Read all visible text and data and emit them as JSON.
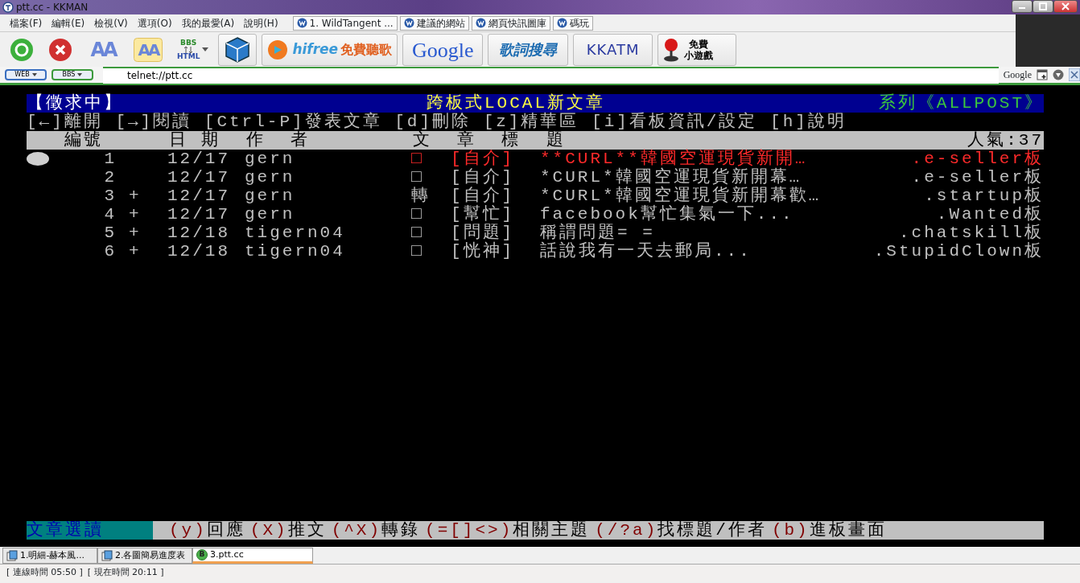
{
  "window": {
    "title": "ptt.cc - KKMAN"
  },
  "menu": [
    "檔案(F)",
    "編輯(E)",
    "檢視(V)",
    "選項(O)",
    "我的最愛(A)",
    "說明(H)"
  ],
  "favorites": [
    "1. WildTangent ...",
    "建議的網站",
    "網頁快訊圖庫",
    "碼玩"
  ],
  "toolbar": [
    {
      "kind": "go"
    },
    {
      "kind": "stop"
    },
    {
      "kind": "font",
      "text": "AA"
    },
    {
      "kind": "font-box",
      "text": "AA"
    },
    {
      "kind": "bbs-html",
      "top": "BBS",
      "bottom": "HTML"
    },
    {
      "kind": "cube"
    },
    {
      "kind": "hifree",
      "text": "hifree",
      "caption": "免費聽歌"
    },
    {
      "kind": "google",
      "text": "Google"
    },
    {
      "kind": "lyrics",
      "text": "歌詞搜尋"
    },
    {
      "kind": "kkatm",
      "text": "KKATM"
    },
    {
      "kind": "games",
      "text": "免費",
      "caption": "小遊戲"
    }
  ],
  "address": {
    "modes": [
      "WEB",
      "BBS"
    ],
    "url": "telnet://ptt.cc",
    "search_label": "Google"
  },
  "terminal": {
    "header": {
      "left": "【徵求中】",
      "center": "跨板式LOCAL新文章",
      "right": "系列《ALLPOST》"
    },
    "commands": "[←]離開 [→]閱讀 [Ctrl-P]發表文章 [d]刪除 [z]精華區 [i]看板資訊/設定 [h]說明",
    "columns": [
      "編號",
      "日 期",
      "作  者",
      "文  章  標  題",
      "人氣:37"
    ],
    "rows": [
      {
        "number": "1",
        "date": "12/17",
        "author": "gern",
        "type": "□",
        "category": "[自介]",
        "title": "**CURL**韓國空運現貨新開…",
        "board": ".e-seller板",
        "selected": true
      },
      {
        "number": "2",
        "date": "12/17",
        "author": "gern",
        "type": "□",
        "category": "[自介]",
        "title": "*CURL*韓國空運現貨新開幕…",
        "board": ".e-seller板",
        "selected": false
      },
      {
        "number": "3",
        "mark": "+",
        "date": "12/17",
        "author": "gern",
        "type": "轉",
        "category": "[自介]",
        "title": "*CURL*韓國空運現貨新開幕歡…",
        "board": ".startup板",
        "selected": false
      },
      {
        "number": "4",
        "mark": "+",
        "date": "12/17",
        "author": "gern",
        "type": "□",
        "category": "[幫忙]",
        "title": "facebook幫忙集氣一下...",
        "board": ".Wanted板",
        "selected": false
      },
      {
        "number": "5",
        "mark": "+",
        "date": "12/18",
        "author": "tigern04",
        "type": "□",
        "category": "[問題]",
        "title": "稱謂問題= =",
        "board": ".chatskill板",
        "selected": false
      },
      {
        "number": "6",
        "mark": "+",
        "date": "12/18",
        "author": "tigern04",
        "type": "□",
        "category": "[恍神]",
        "title": "話說我有一天去郵局...",
        "board": ".StupidClown板",
        "selected": false
      }
    ],
    "footer": {
      "label": "文章選讀",
      "actions": [
        {
          "key": "(y)",
          "action": "回應"
        },
        {
          "key": "(X)",
          "action": "推文"
        },
        {
          "key": "(^X)",
          "action": "轉錄"
        },
        {
          "key": "(=[]<>)",
          "action": "相關主題"
        },
        {
          "key": "(/?a)",
          "action": "找標題/作者"
        },
        {
          "key": "(b)",
          "action": "進板畫面"
        }
      ]
    }
  },
  "tabs": [
    {
      "label": "1.明細-赫本風...",
      "kind": "doc",
      "selected": false
    },
    {
      "label": "2.各圖簡易進度表",
      "kind": "doc",
      "selected": false
    },
    {
      "label": "3.ptt.cc",
      "kind": "bbs",
      "icon_letter": "B",
      "selected": true
    }
  ],
  "status_bar": [
    "[ 連線時間 05:50 ]",
    "[ 現在時間 20:11 ]"
  ]
}
